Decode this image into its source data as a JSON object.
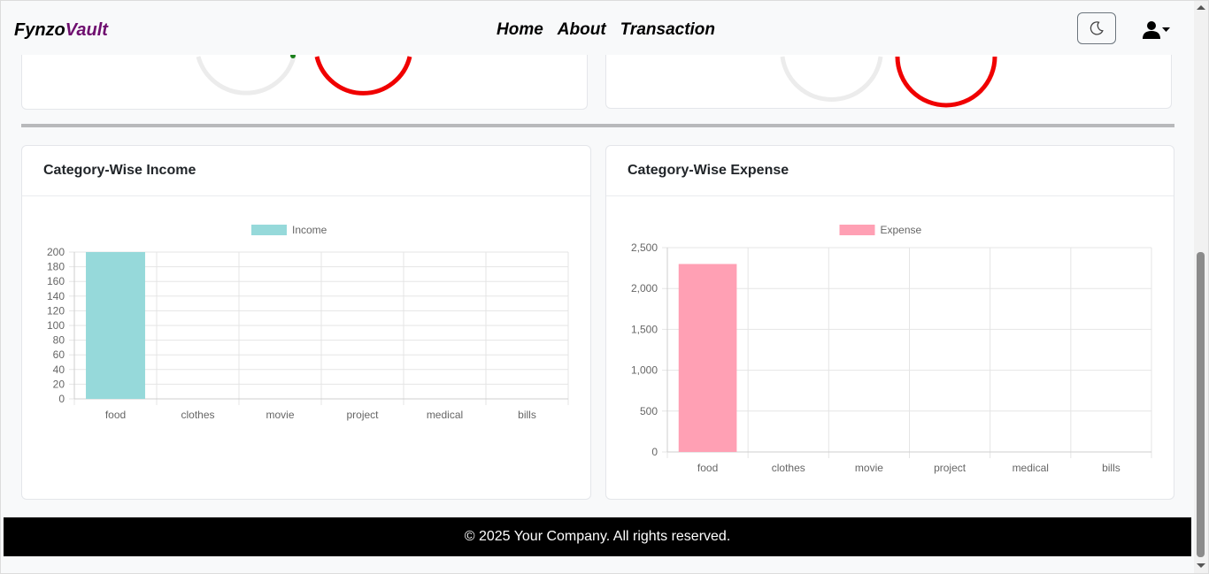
{
  "nav": {
    "brand_part1": "Fynzo",
    "brand_part2": "Vault",
    "links": [
      "Home",
      "About",
      "Transaction"
    ],
    "theme_toggle_icon": "moon-icon",
    "user_icon": "user-icon"
  },
  "top_cards": [
    {
      "gauges": [
        {
          "color": "#ececec",
          "accent": "#1a7f1a"
        },
        {
          "color": "#f00000"
        }
      ]
    },
    {
      "gauges": [
        {
          "color": "#ececec"
        },
        {
          "color": "#f00000"
        }
      ]
    }
  ],
  "income_card": {
    "title": "Category-Wise Income"
  },
  "expense_card": {
    "title": "Category-Wise Expense"
  },
  "chart_data": [
    {
      "type": "bar",
      "title": "",
      "categories": [
        "food",
        "clothes",
        "movie",
        "project",
        "medical",
        "bills"
      ],
      "series": [
        {
          "name": "Income",
          "values": [
            200,
            0,
            0,
            0,
            0,
            0
          ],
          "color": "#96d9da"
        }
      ],
      "ylim": [
        0,
        200
      ],
      "yticks": [
        "0",
        "20",
        "40",
        "60",
        "80",
        "100",
        "120",
        "140",
        "160",
        "180",
        "200"
      ],
      "yticks_values": [
        0,
        20,
        40,
        60,
        80,
        100,
        120,
        140,
        160,
        180,
        200
      ],
      "grid": true,
      "legend": "top-center"
    },
    {
      "type": "bar",
      "title": "",
      "categories": [
        "food",
        "clothes",
        "movie",
        "project",
        "medical",
        "bills"
      ],
      "series": [
        {
          "name": "Expense",
          "values": [
            2300,
            0,
            0,
            0,
            0,
            0
          ],
          "color": "#ffa0b4"
        }
      ],
      "ylim": [
        0,
        2500
      ],
      "yticks": [
        "0",
        "500",
        "1,000",
        "1,500",
        "2,000",
        "2,500"
      ],
      "yticks_values": [
        0,
        500,
        1000,
        1500,
        2000,
        2500
      ],
      "grid": true,
      "legend": "top-center"
    }
  ],
  "footer": {
    "text": "© 2025 Your Company. All rights reserved."
  }
}
